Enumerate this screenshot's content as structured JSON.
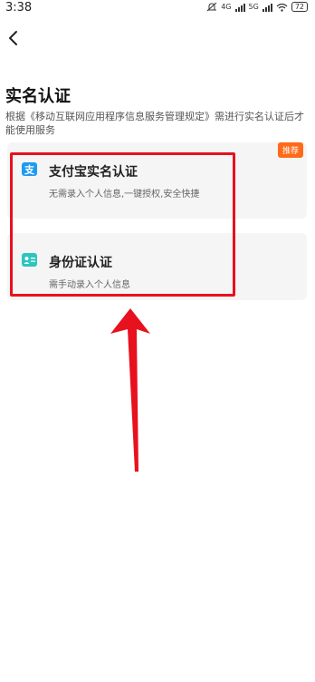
{
  "status_bar": {
    "time": "3:38",
    "net1": "4G",
    "net2": "5G",
    "battery": "72"
  },
  "page": {
    "title": "实名认证",
    "description": "根据《移动互联网应用程序信息服务管理规定》需进行实名认证后才能使用服务"
  },
  "cards": [
    {
      "title": "支付宝实名认证",
      "subtitle": "无需录入个人信息,一键授权,安全快捷",
      "badge": "推荐",
      "icon": "alipay-icon",
      "icon_color": "#1E9BF0"
    },
    {
      "title": "身份证认证",
      "subtitle": "需手动录入个人信息",
      "icon": "id-card-icon",
      "icon_color": "#2EC5C0"
    }
  ],
  "colors": {
    "badge": "#FF6A1A",
    "highlight": "#E8111E",
    "card_bg": "#F5F5F5"
  }
}
